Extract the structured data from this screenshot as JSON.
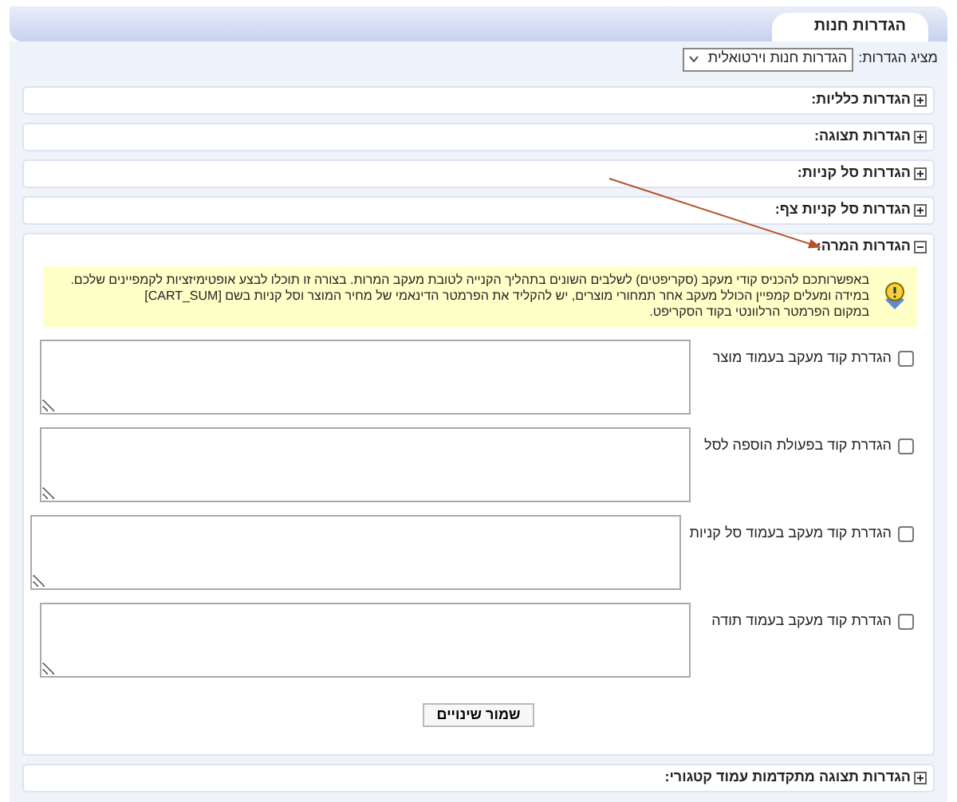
{
  "header": {
    "title": "הגדרות חנות"
  },
  "view_selector": {
    "label": "מציג הגדרות:",
    "value": "הגדרות חנות וירטואלית"
  },
  "sections": [
    {
      "title": "הגדרות כלליות:",
      "expanded": false
    },
    {
      "title": "הגדרות תצוגה:",
      "expanded": false
    },
    {
      "title": "הגדרות סל קניות:",
      "expanded": false
    },
    {
      "title": "הגדרות סל קניות צף:",
      "expanded": false
    },
    {
      "title": "הגדרות המרה:",
      "expanded": true,
      "notice": [
        "באפשרותכם להכניס קודי מעקב (סקריפטים) לשלבים השונים בתהליך הקנייה לטובת מעקב המרות. בצורה זו תוכלו לבצע אופטימיזציות לקמפיינים שלכם.",
        "במידה ומעלים קמפיין הכולל מעקב אחר תמחורי מוצרים, יש להקליד את הפרמטר הדינאמי של מחיר המוצר וסל קניות בשם [CART_SUM]",
        "במקום הפרמטר הרלוונטי בקוד הסקריפט."
      ],
      "fields": [
        {
          "label": "הגדרת קוד מעקב בעמוד מוצר",
          "checked": false
        },
        {
          "label": "הגדרת קוד בפעולת הוספה לסל",
          "checked": false
        },
        {
          "label": "הגדרת קוד מעקב בעמוד סל קניות",
          "checked": false
        },
        {
          "label": "הגדרת קוד מעקב בעמוד תודה",
          "checked": false
        }
      ],
      "save_button": "שמור שינויים"
    },
    {
      "title": "הגדרות תצוגה מתקדמות עמוד קטגורי:",
      "expanded": false
    }
  ]
}
